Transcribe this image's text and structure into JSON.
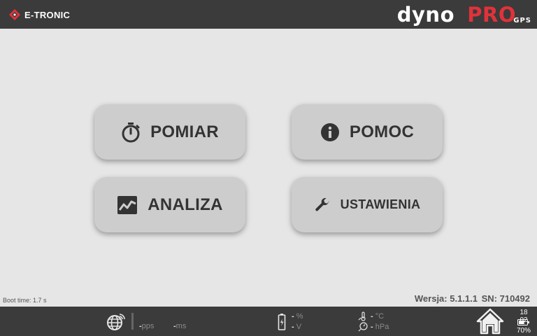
{
  "header": {
    "brand_name": "E-TRONIC",
    "product_main": "dyno",
    "product_accent": "PRO",
    "product_sub": "GPS",
    "accent_color": "#e0323b"
  },
  "menu": [
    {
      "label": "POMIAR",
      "icon": "stopwatch-icon"
    },
    {
      "label": "POMOC",
      "icon": "info-icon"
    },
    {
      "label": "ANALIZA",
      "icon": "chart-icon"
    },
    {
      "label": "USTAWIENIA",
      "icon": "wrench-icon"
    }
  ],
  "footer": {
    "boot_time": "Boot time: 1.7 s",
    "version_label": "Wersja: 5.1.1.1",
    "serial_label": "SN: 710492"
  },
  "status": {
    "gps_pps": "-",
    "gps_pps_unit": "pps",
    "gps_ms": "-",
    "gps_ms_unit": "ms",
    "battery_pct_val": "-",
    "battery_pct_unit": "%",
    "voltage_val": "-",
    "voltage_unit": "V",
    "temp_val": "-",
    "temp_unit": "°C",
    "pressure_val": "-",
    "pressure_unit": "hPa",
    "clock": "18 02",
    "device_battery": "70%",
    "device_battery_level": 0.7
  }
}
